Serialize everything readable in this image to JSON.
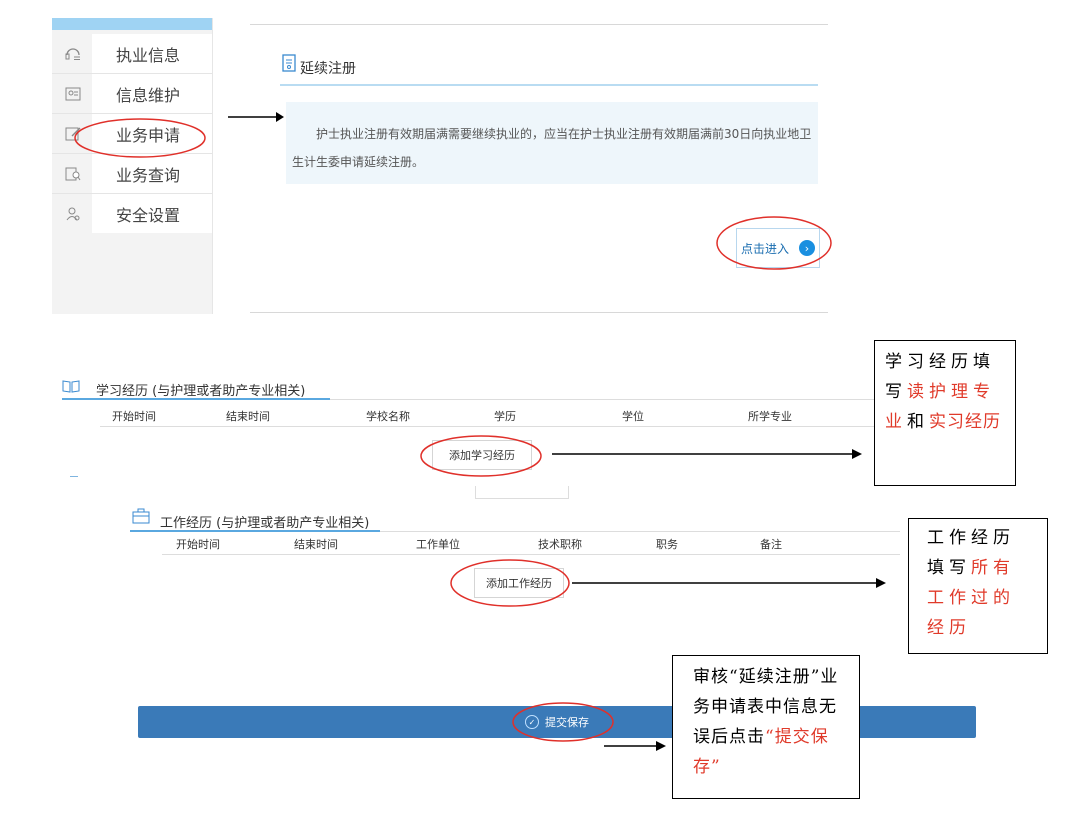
{
  "sidebar": {
    "items": [
      {
        "label": "执业信息",
        "icon": "headset-icon"
      },
      {
        "label": "信息维护",
        "icon": "id-card-icon"
      },
      {
        "label": "业务申请",
        "icon": "edit-doc-icon"
      },
      {
        "label": "业务查询",
        "icon": "search-doc-icon"
      },
      {
        "label": "安全设置",
        "icon": "user-shield-icon"
      }
    ]
  },
  "renew": {
    "title": "延续注册",
    "description": "护士执业注册有效期届满需要继续执业的，应当在护士执业注册有效期届满前30日向执业地卫生计生委申请延续注册。",
    "enter_label": "点击进入"
  },
  "study": {
    "title": "学习经历 (与护理或者助产专业相关)",
    "columns": [
      "开始时间",
      "结束时间",
      "学校名称",
      "学历",
      "学位",
      "所学专业"
    ],
    "add_label": "添加学习经历"
  },
  "work": {
    "title": "工作经历 (与护理或者助产专业相关)",
    "columns": [
      "开始时间",
      "结束时间",
      "工作单位",
      "技术职称",
      "职务",
      "备注"
    ],
    "add_label": "添加工作经历"
  },
  "submit_label": "提交保存",
  "notes": {
    "study": {
      "pre": "学习经历填写",
      "red1": "读护理专业",
      "mid": "和",
      "red2": "实习经历"
    },
    "work": {
      "pre": "工作经历填写",
      "red": "所有工作过的经历"
    },
    "submit": {
      "pre": "审核“延续注册”业务申请表中信息无误后点击",
      "red": "“提交保存”"
    }
  },
  "colors": {
    "accent": "#3a7ab8",
    "highlight_circle": "#e0302a",
    "note_red": "#e03a2a"
  }
}
